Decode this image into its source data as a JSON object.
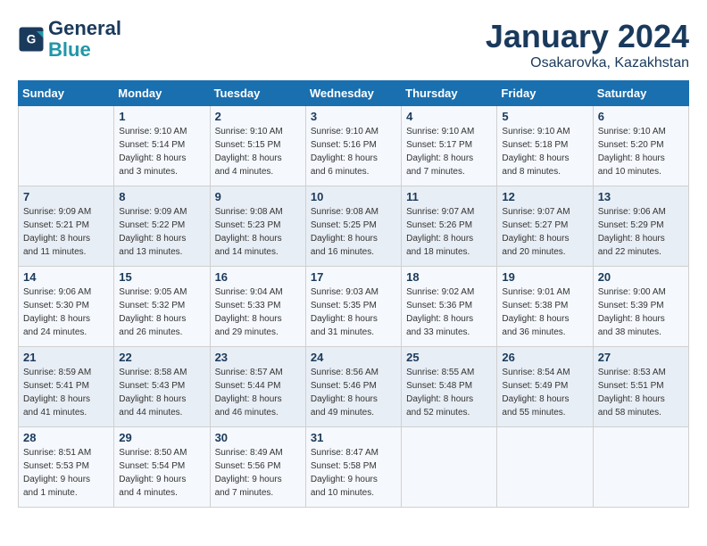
{
  "header": {
    "logo_line1": "General",
    "logo_line2": "Blue",
    "month_year": "January 2024",
    "location": "Osakarovka, Kazakhstan"
  },
  "weekdays": [
    "Sunday",
    "Monday",
    "Tuesday",
    "Wednesday",
    "Thursday",
    "Friday",
    "Saturday"
  ],
  "weeks": [
    [
      {
        "day": "",
        "info": ""
      },
      {
        "day": "1",
        "info": "Sunrise: 9:10 AM\nSunset: 5:14 PM\nDaylight: 8 hours\nand 3 minutes."
      },
      {
        "day": "2",
        "info": "Sunrise: 9:10 AM\nSunset: 5:15 PM\nDaylight: 8 hours\nand 4 minutes."
      },
      {
        "day": "3",
        "info": "Sunrise: 9:10 AM\nSunset: 5:16 PM\nDaylight: 8 hours\nand 6 minutes."
      },
      {
        "day": "4",
        "info": "Sunrise: 9:10 AM\nSunset: 5:17 PM\nDaylight: 8 hours\nand 7 minutes."
      },
      {
        "day": "5",
        "info": "Sunrise: 9:10 AM\nSunset: 5:18 PM\nDaylight: 8 hours\nand 8 minutes."
      },
      {
        "day": "6",
        "info": "Sunrise: 9:10 AM\nSunset: 5:20 PM\nDaylight: 8 hours\nand 10 minutes."
      }
    ],
    [
      {
        "day": "7",
        "info": "Sunrise: 9:09 AM\nSunset: 5:21 PM\nDaylight: 8 hours\nand 11 minutes."
      },
      {
        "day": "8",
        "info": "Sunrise: 9:09 AM\nSunset: 5:22 PM\nDaylight: 8 hours\nand 13 minutes."
      },
      {
        "day": "9",
        "info": "Sunrise: 9:08 AM\nSunset: 5:23 PM\nDaylight: 8 hours\nand 14 minutes."
      },
      {
        "day": "10",
        "info": "Sunrise: 9:08 AM\nSunset: 5:25 PM\nDaylight: 8 hours\nand 16 minutes."
      },
      {
        "day": "11",
        "info": "Sunrise: 9:07 AM\nSunset: 5:26 PM\nDaylight: 8 hours\nand 18 minutes."
      },
      {
        "day": "12",
        "info": "Sunrise: 9:07 AM\nSunset: 5:27 PM\nDaylight: 8 hours\nand 20 minutes."
      },
      {
        "day": "13",
        "info": "Sunrise: 9:06 AM\nSunset: 5:29 PM\nDaylight: 8 hours\nand 22 minutes."
      }
    ],
    [
      {
        "day": "14",
        "info": "Sunrise: 9:06 AM\nSunset: 5:30 PM\nDaylight: 8 hours\nand 24 minutes."
      },
      {
        "day": "15",
        "info": "Sunrise: 9:05 AM\nSunset: 5:32 PM\nDaylight: 8 hours\nand 26 minutes."
      },
      {
        "day": "16",
        "info": "Sunrise: 9:04 AM\nSunset: 5:33 PM\nDaylight: 8 hours\nand 29 minutes."
      },
      {
        "day": "17",
        "info": "Sunrise: 9:03 AM\nSunset: 5:35 PM\nDaylight: 8 hours\nand 31 minutes."
      },
      {
        "day": "18",
        "info": "Sunrise: 9:02 AM\nSunset: 5:36 PM\nDaylight: 8 hours\nand 33 minutes."
      },
      {
        "day": "19",
        "info": "Sunrise: 9:01 AM\nSunset: 5:38 PM\nDaylight: 8 hours\nand 36 minutes."
      },
      {
        "day": "20",
        "info": "Sunrise: 9:00 AM\nSunset: 5:39 PM\nDaylight: 8 hours\nand 38 minutes."
      }
    ],
    [
      {
        "day": "21",
        "info": "Sunrise: 8:59 AM\nSunset: 5:41 PM\nDaylight: 8 hours\nand 41 minutes."
      },
      {
        "day": "22",
        "info": "Sunrise: 8:58 AM\nSunset: 5:43 PM\nDaylight: 8 hours\nand 44 minutes."
      },
      {
        "day": "23",
        "info": "Sunrise: 8:57 AM\nSunset: 5:44 PM\nDaylight: 8 hours\nand 46 minutes."
      },
      {
        "day": "24",
        "info": "Sunrise: 8:56 AM\nSunset: 5:46 PM\nDaylight: 8 hours\nand 49 minutes."
      },
      {
        "day": "25",
        "info": "Sunrise: 8:55 AM\nSunset: 5:48 PM\nDaylight: 8 hours\nand 52 minutes."
      },
      {
        "day": "26",
        "info": "Sunrise: 8:54 AM\nSunset: 5:49 PM\nDaylight: 8 hours\nand 55 minutes."
      },
      {
        "day": "27",
        "info": "Sunrise: 8:53 AM\nSunset: 5:51 PM\nDaylight: 8 hours\nand 58 minutes."
      }
    ],
    [
      {
        "day": "28",
        "info": "Sunrise: 8:51 AM\nSunset: 5:53 PM\nDaylight: 9 hours\nand 1 minute."
      },
      {
        "day": "29",
        "info": "Sunrise: 8:50 AM\nSunset: 5:54 PM\nDaylight: 9 hours\nand 4 minutes."
      },
      {
        "day": "30",
        "info": "Sunrise: 8:49 AM\nSunset: 5:56 PM\nDaylight: 9 hours\nand 7 minutes."
      },
      {
        "day": "31",
        "info": "Sunrise: 8:47 AM\nSunset: 5:58 PM\nDaylight: 9 hours\nand 10 minutes."
      },
      {
        "day": "",
        "info": ""
      },
      {
        "day": "",
        "info": ""
      },
      {
        "day": "",
        "info": ""
      }
    ]
  ]
}
